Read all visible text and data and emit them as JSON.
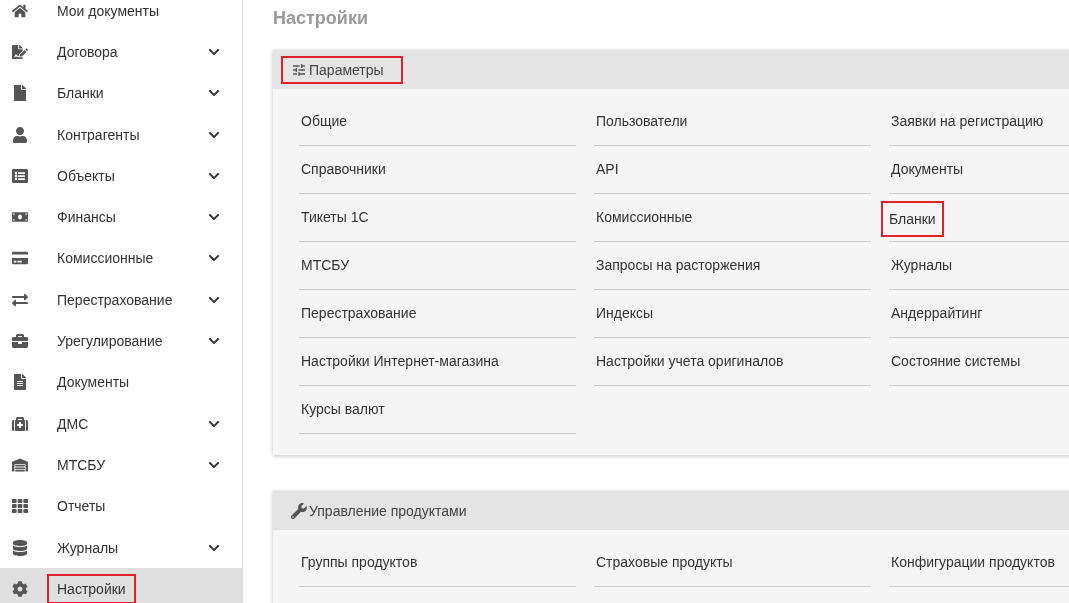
{
  "sidebar": {
    "items": [
      {
        "label": "Мои документы",
        "kind": "link",
        "selected": false,
        "highlighted": false
      },
      {
        "label": "Договора",
        "kind": "group",
        "selected": false,
        "highlighted": false
      },
      {
        "label": "Бланки",
        "kind": "group",
        "selected": false,
        "highlighted": false
      },
      {
        "label": "Контрагенты",
        "kind": "group",
        "selected": false,
        "highlighted": false
      },
      {
        "label": "Объекты",
        "kind": "group",
        "selected": false,
        "highlighted": false
      },
      {
        "label": "Финансы",
        "kind": "group",
        "selected": false,
        "highlighted": false
      },
      {
        "label": "Комиссионные",
        "kind": "group",
        "selected": false,
        "highlighted": false
      },
      {
        "label": "Перестрахование",
        "kind": "group",
        "selected": false,
        "highlighted": false
      },
      {
        "label": "Урегулирование",
        "kind": "group",
        "selected": false,
        "highlighted": false
      },
      {
        "label": "Документы",
        "kind": "link",
        "selected": false,
        "highlighted": false
      },
      {
        "label": "ДМС",
        "kind": "group",
        "selected": false,
        "highlighted": false
      },
      {
        "label": "МТСБУ",
        "kind": "group",
        "selected": false,
        "highlighted": false
      },
      {
        "label": "Отчеты",
        "kind": "link",
        "selected": false,
        "highlighted": false
      },
      {
        "label": "Журналы",
        "kind": "group",
        "selected": false,
        "highlighted": false
      },
      {
        "label": "Настройки",
        "kind": "link",
        "selected": true,
        "highlighted": true
      }
    ]
  },
  "page": {
    "title": "Настройки"
  },
  "sections": [
    {
      "title": "Параметры",
      "highlighted": true,
      "links": [
        {
          "label": "Общие",
          "highlighted": false
        },
        {
          "label": "Пользователи",
          "highlighted": false
        },
        {
          "label": "Заявки на регистрацию",
          "highlighted": false
        },
        {
          "label": "Справочники",
          "highlighted": false
        },
        {
          "label": "API",
          "highlighted": false
        },
        {
          "label": "Документы",
          "highlighted": false
        },
        {
          "label": "Тикеты 1С",
          "highlighted": false
        },
        {
          "label": "Комиссионные",
          "highlighted": false
        },
        {
          "label": "Бланки",
          "highlighted": true
        },
        {
          "label": "МТСБУ",
          "highlighted": false
        },
        {
          "label": "Запросы на расторжения",
          "highlighted": false
        },
        {
          "label": "Журналы",
          "highlighted": false
        },
        {
          "label": "Перестрахование",
          "highlighted": false
        },
        {
          "label": "Индексы",
          "highlighted": false
        },
        {
          "label": "Андеррайтинг",
          "highlighted": false
        },
        {
          "label": "Настройки Интернет-магазина",
          "highlighted": false
        },
        {
          "label": "Настройки учета оригиналов",
          "highlighted": false
        },
        {
          "label": "Состояние системы",
          "highlighted": false
        },
        {
          "label": "Курсы валют",
          "highlighted": false
        }
      ]
    },
    {
      "title": "Управление продуктами",
      "highlighted": false,
      "links": [
        {
          "label": "Группы продуктов",
          "highlighted": false
        },
        {
          "label": "Страховые продукты",
          "highlighted": false
        },
        {
          "label": "Конфигурации продуктов",
          "highlighted": false
        }
      ]
    }
  ]
}
